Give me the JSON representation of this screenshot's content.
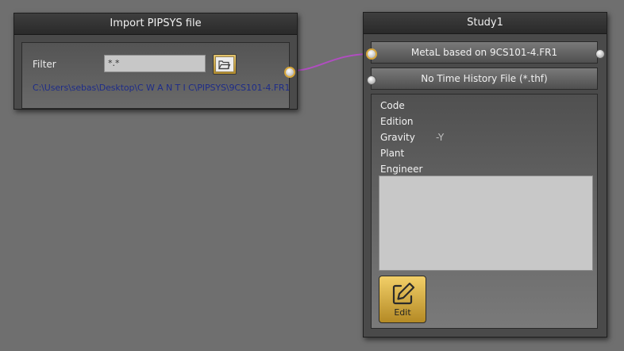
{
  "import_node": {
    "title": "Import PIPSYS file",
    "filter_label": "Filter",
    "filter_value": "*.*",
    "browse_icon": "folder-open-icon",
    "file_path": "C:\\Users\\sebas\\Desktop\\C W A N T I C\\PIPSYS\\9CS101-4.FR1"
  },
  "study_node": {
    "title": "Study1",
    "input_label": "MetaL based on 9CS101-4.FR1",
    "history_label": "No Time History File (*.thf)",
    "properties": [
      {
        "label": "Code",
        "value": ""
      },
      {
        "label": "Edition",
        "value": ""
      },
      {
        "label": "Gravity",
        "value": "-Y"
      },
      {
        "label": "Plant",
        "value": ""
      },
      {
        "label": "Engineer",
        "value": ""
      }
    ],
    "notes_value": "",
    "edit_label": "Edit",
    "edit_icon": "pencil-square-icon"
  },
  "connection": {
    "color": "#b04ec0"
  },
  "colors": {
    "canvas": "#6f6f6f",
    "accent_gold": "#d7a63a",
    "path_text": "#1e2c88"
  }
}
